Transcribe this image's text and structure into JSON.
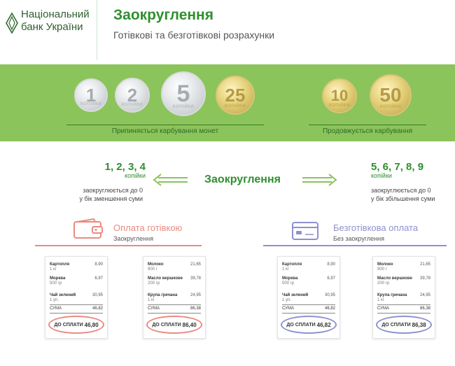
{
  "header": {
    "logo_line1": "Національний",
    "logo_line2": "банк України",
    "title": "Заокруглення",
    "subtitle": "Готівкові та безготівкові розрахунки"
  },
  "coins": {
    "discontinued": [
      {
        "value": "1",
        "kind": "silver"
      },
      {
        "value": "2",
        "kind": "silver"
      },
      {
        "value": "5",
        "kind": "silver"
      },
      {
        "value": "25",
        "kind": "gold"
      }
    ],
    "continued": [
      {
        "value": "10",
        "kind": "gold"
      },
      {
        "value": "50",
        "kind": "gold"
      }
    ],
    "coin_label": "КОПІЙКИ",
    "discontinued_caption": "Припиняється карбування монет",
    "continued_caption": "Продовжується карбування"
  },
  "rounding": {
    "center_title": "Заокруглення",
    "left_numbers": "1, 2, 3, 4",
    "left_unit": "копійки",
    "left_note_1": "заокруглюється до 0",
    "left_note_2": "у бік зменшення суми",
    "right_numbers": "5, 6, 7, 8, 9",
    "right_unit": "копійки",
    "right_note_1": "заокруглюється до 0",
    "right_note_2": "у бік збільшення суми"
  },
  "payments": {
    "cash": {
      "title": "Оплата готівкою",
      "subtitle": "Заокруглення",
      "color": "#ea8a82"
    },
    "cashless": {
      "title": "Безготівкова оплата",
      "subtitle": "Без заокруглення",
      "color": "#8e91cf"
    }
  },
  "receipts": [
    {
      "items": [
        {
          "name": "Картопля",
          "qty": "1 кг",
          "price": "8,90"
        },
        {
          "name": "Морква",
          "qty": "500 гр",
          "price": "6,97"
        },
        {
          "name": "Чай зелений",
          "qty": "1 уп.",
          "price": "30,95"
        }
      ],
      "sum_label": "СУМА",
      "sum": "46,82",
      "pay_label": "ДО СПЛАТИ",
      "pay": "46,80"
    },
    {
      "items": [
        {
          "name": "Молоко",
          "qty": "900 г",
          "price": "21,65"
        },
        {
          "name": "Масло вершкове",
          "qty": "200 гр",
          "price": "39,78"
        },
        {
          "name": "Крупа гречана",
          "qty": "1 кг",
          "price": "24,95"
        }
      ],
      "sum_label": "СУМА",
      "sum": "86,38",
      "pay_label": "ДО СПЛАТИ",
      "pay": "86,40"
    },
    {
      "items": [
        {
          "name": "Картопля",
          "qty": "1 кг",
          "price": "8,90"
        },
        {
          "name": "Морква",
          "qty": "500 гр",
          "price": "6,97"
        },
        {
          "name": "Чай зелений",
          "qty": "1 уп.",
          "price": "30,95"
        }
      ],
      "sum_label": "СУМА",
      "sum": "46,82",
      "pay_label": "ДО СПЛАТИ",
      "pay": "46,82"
    },
    {
      "items": [
        {
          "name": "Молоко",
          "qty": "900 г",
          "price": "21,65"
        },
        {
          "name": "Масло вершкове",
          "qty": "200 гр",
          "price": "39,78"
        },
        {
          "name": "Крупа гречана",
          "qty": "1 кг",
          "price": "24,95"
        }
      ],
      "sum_label": "СУМА",
      "sum": "86,38",
      "pay_label": "ДО СПЛАТИ",
      "pay": "86,38"
    }
  ],
  "colors": {
    "brand_green": "#2f8f2f",
    "band_green": "#8bc45a",
    "cash_accent": "#ea8a82",
    "cashless_accent": "#8e91cf"
  }
}
